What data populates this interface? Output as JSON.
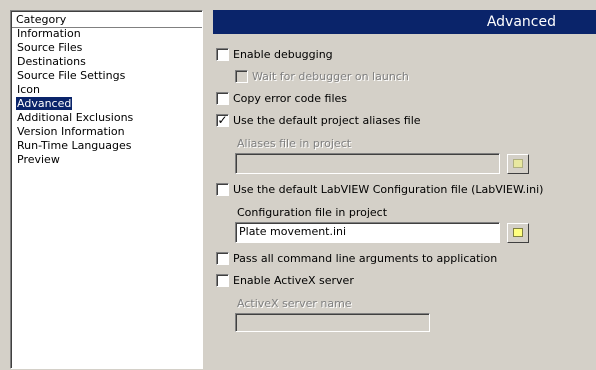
{
  "sidebar": {
    "header": "Category",
    "items": [
      {
        "label": "Information"
      },
      {
        "label": "Source Files"
      },
      {
        "label": "Destinations"
      },
      {
        "label": "Source File Settings"
      },
      {
        "label": "Icon"
      },
      {
        "label": "Advanced",
        "selected": true
      },
      {
        "label": "Additional Exclusions"
      },
      {
        "label": "Version Information"
      },
      {
        "label": "Run-Time Languages"
      },
      {
        "label": "Preview"
      }
    ]
  },
  "content": {
    "title": "Advanced",
    "enable_debugging": {
      "label": "Enable debugging",
      "checked": false
    },
    "wait_for_debugger": {
      "label": "Wait for debugger on launch",
      "checked": false,
      "enabled": false
    },
    "copy_error_code_files": {
      "label": "Copy error code files",
      "checked": false
    },
    "use_default_aliases": {
      "label": "Use the default project aliases file",
      "checked": true
    },
    "aliases_file": {
      "label": "Aliases file in project",
      "value": "",
      "enabled": false
    },
    "use_default_config": {
      "label": "Use the default LabVIEW Configuration file (LabVIEW.ini)",
      "checked": false
    },
    "config_file": {
      "label": "Configuration file in project",
      "value": "Plate movement.ini",
      "enabled": true
    },
    "pass_cmd_args": {
      "label": "Pass all command line arguments to application",
      "checked": false
    },
    "enable_activex": {
      "label": "Enable ActiveX server",
      "checked": false
    },
    "activex_name": {
      "label": "ActiveX server name",
      "value": "",
      "enabled": false
    }
  },
  "icons": {
    "check": "✓",
    "browse": "folder-browse-icon"
  }
}
